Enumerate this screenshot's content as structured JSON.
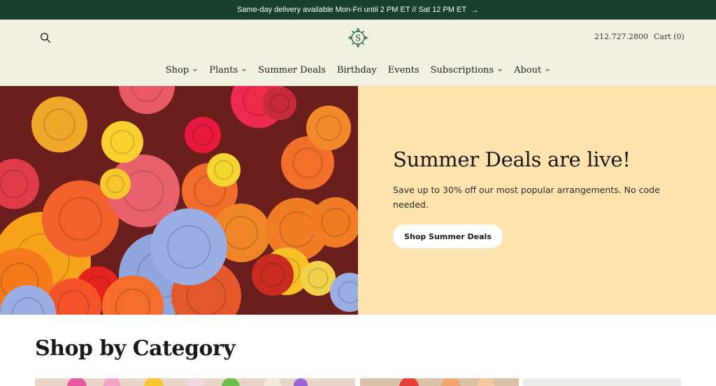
{
  "announcement": {
    "text": "Same-day delivery available Mon-Fri until 2 PM ET // Sat 12 PM ET",
    "arrow": "→"
  },
  "header": {
    "search_icon": "search-icon",
    "logo_letter": "S",
    "phone": "212.727.2800",
    "cart": "Cart (0)"
  },
  "nav": {
    "items": [
      {
        "label": "Shop",
        "dropdown": true
      },
      {
        "label": "Plants",
        "dropdown": true
      },
      {
        "label": "Summer Deals",
        "dropdown": false
      },
      {
        "label": "Birthday",
        "dropdown": false
      },
      {
        "label": "Events",
        "dropdown": false
      },
      {
        "label": "Subscriptions",
        "dropdown": true
      },
      {
        "label": "About",
        "dropdown": true
      }
    ]
  },
  "hero": {
    "title": "Summer Deals are live!",
    "text": "Save up to 30% off our most popular arrangements. No code needed.",
    "button": "Shop Summer Deals"
  },
  "category": {
    "title": "Shop by Category"
  },
  "colors": {
    "announcement_bg": "#16412f",
    "header_bg": "#f1f1e2",
    "hero_panel_bg": "#ffe3ae",
    "logo_green": "#1f4a36"
  }
}
